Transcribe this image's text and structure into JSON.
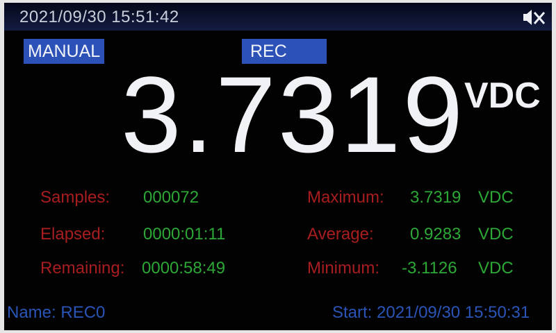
{
  "header": {
    "datetime": "2021/09/30 15:51:42",
    "sound_icon": "speaker-muted-icon"
  },
  "mode": {
    "manual_label": "MANUAL",
    "rec_label": "REC"
  },
  "measurement": {
    "value": "3.7319",
    "unit": "VDC"
  },
  "stats": {
    "samples_label": "Samples:",
    "samples_value": "000072",
    "elapsed_label": "Elapsed:",
    "elapsed_value": "0000:01:11",
    "remaining_label": "Remaining:",
    "remaining_value": "0000:58:49",
    "maximum_label": "Maximum:",
    "maximum_value": "3.7319",
    "maximum_unit": "VDC",
    "average_label": "Average:",
    "average_value": "0.9283",
    "average_unit": "VDC",
    "minimum_label": "Minimum:",
    "minimum_value": "-3.1126",
    "minimum_unit": "VDC"
  },
  "footer": {
    "name_text": "Name: REC0",
    "start_text": "Start: 2021/09/30 15:50:31"
  },
  "colors": {
    "background": "#020203",
    "label_red": "#a81d1f",
    "value_green": "#2da836",
    "badge_blue": "#2c52b8",
    "footer_blue": "#2a54b6"
  }
}
